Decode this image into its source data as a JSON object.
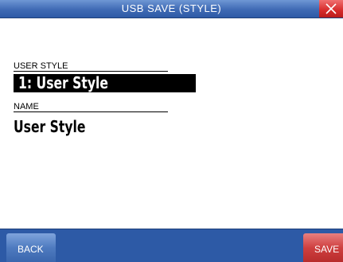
{
  "window": {
    "title": "USB SAVE (STYLE)"
  },
  "form": {
    "user_style_label": "USER STYLE",
    "user_style_value": "1: User Style",
    "name_label": "NAME",
    "name_value": "User Style"
  },
  "footer": {
    "back_label": "BACK",
    "save_label": "SAVE"
  },
  "icons": {
    "close": "close-icon"
  },
  "colors": {
    "title_bar": "#3f6ab4",
    "close_button": "#d62a2a",
    "footer_bar": "#2d5aa6",
    "back_button": "#4f7bc0",
    "save_button": "#cf4040",
    "selected_field": "#000000"
  }
}
